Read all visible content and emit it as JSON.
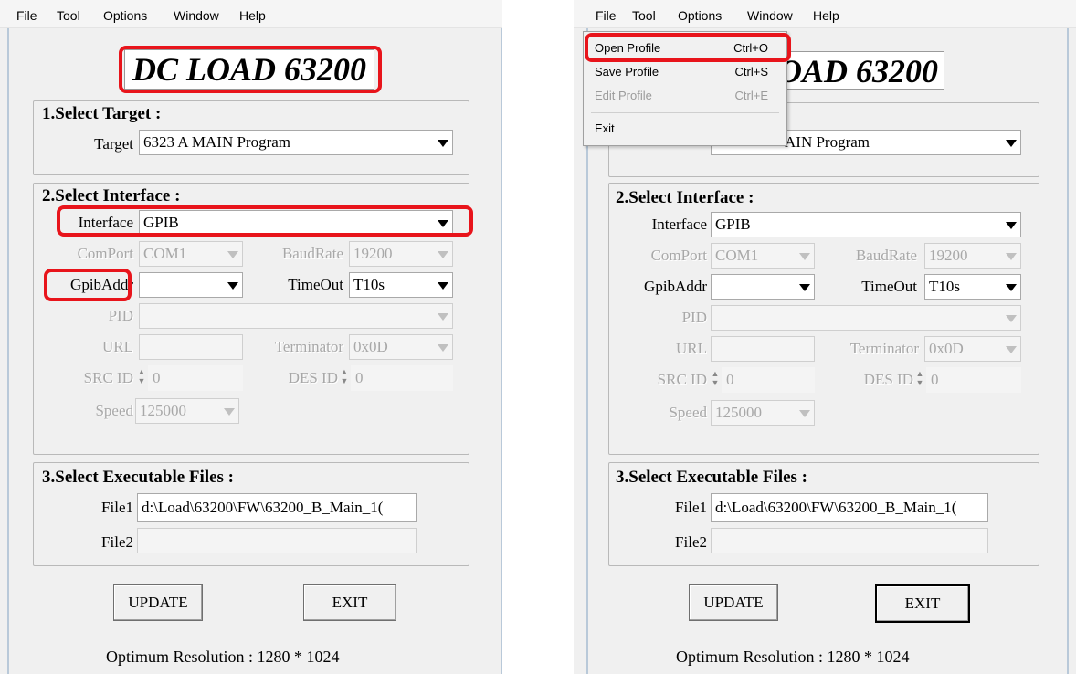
{
  "menu": {
    "file": "File",
    "tool": "Tool",
    "options": "Options",
    "window": "Window",
    "help": "Help"
  },
  "app_title": "DC LOAD 63200",
  "target_group": {
    "title": "1.Select Target :",
    "target_label": "Target",
    "target_value": "6323 A MAIN Program"
  },
  "target_partial": "AIN Program",
  "interface_group": {
    "title": "2.Select Interface :",
    "interface_label": "Interface",
    "interface_value": "GPIB",
    "comport_label": "ComPort",
    "comport_value": "COM1",
    "baudrate_label": "BaudRate",
    "baudrate_value": "19200",
    "gpibaddr_label": "GpibAddr",
    "gpibaddr_value": "",
    "timeout_label": "TimeOut",
    "timeout_value": "T10s",
    "pid_label": "PID",
    "pid_value": "",
    "url_label": "URL",
    "url_value": "",
    "terminator_label": "Terminator",
    "terminator_value": "0x0D",
    "srcid_label": "SRC ID",
    "srcid_value": "0",
    "desid_label": "DES ID",
    "desid_value": "0",
    "speed_label": "Speed",
    "speed_value": "125000"
  },
  "files_group": {
    "title": "3.Select Executable Files :",
    "file1_label": "File1",
    "file1_value": "d:\\Load\\63200\\FW\\63200_B_Main_1(",
    "file2_label": "File2",
    "file2_value": ""
  },
  "buttons": {
    "update": "UPDATE",
    "exit": "EXIT"
  },
  "status": "Optimum Resolution : 1280 * 1024",
  "file_menu": {
    "items": [
      {
        "label": "Open Profile",
        "shortcut": "Ctrl+O",
        "enabled": true
      },
      {
        "label": "Save Profile",
        "shortcut": "Ctrl+S",
        "enabled": true
      },
      {
        "label": "Edit Profile",
        "shortcut": "Ctrl+E",
        "enabled": false
      },
      {
        "label": "Exit",
        "shortcut": "",
        "enabled": true
      }
    ]
  },
  "colors": {
    "highlight": "#e8141b",
    "background": "#f0f0f0",
    "disabled_text": "#a8a8a8"
  }
}
